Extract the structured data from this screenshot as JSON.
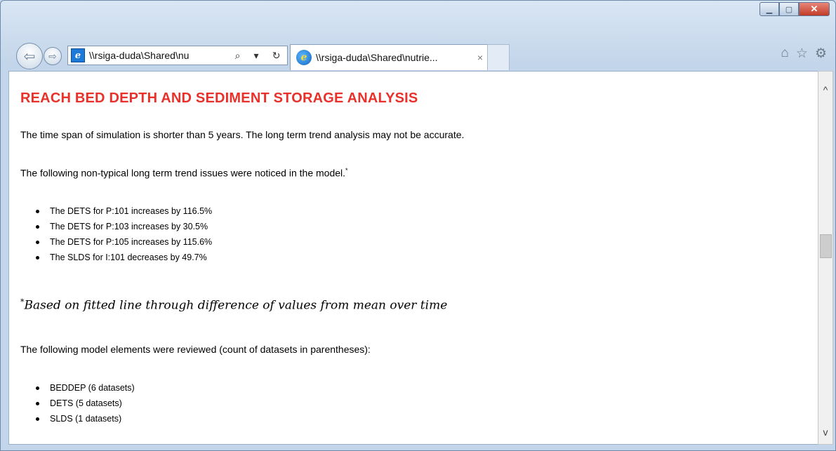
{
  "browser": {
    "address_url": "\\\\rsiga-duda\\Shared\\nu",
    "tab_title": "\\\\rsiga-duda\\Shared\\nutrie...",
    "tab_close": "×",
    "search_glyph": "⌕",
    "dropdown_glyph": "▾",
    "refresh_glyph": "↻"
  },
  "page": {
    "heading": "REACH BED DEPTH AND SEDIMENT STORAGE ANALYSIS",
    "timespan_note": "The time span of simulation is shorter than 5 years. The long term trend analysis may not be accurate.",
    "issues_intro": "The following non-typical long term trend issues were noticed in the model.",
    "issues_marker": "*",
    "issues": [
      "The DETS for P:101 increases by 116.5%",
      "The DETS for P:103 increases by 30.5%",
      "The DETS for P:105 increases by 115.6%",
      "The SLDS for I:101 decreases by 49.7%"
    ],
    "footnote_marker": "*",
    "footnote": "Based on fitted line through difference of values from mean over time",
    "reviewed_intro": "The following model elements were reviewed (count of datasets in parentheses):",
    "reviewed": [
      "BEDDEP (6 datasets)",
      "DETS (5 datasets)",
      "SLDS (1 datasets)"
    ]
  }
}
